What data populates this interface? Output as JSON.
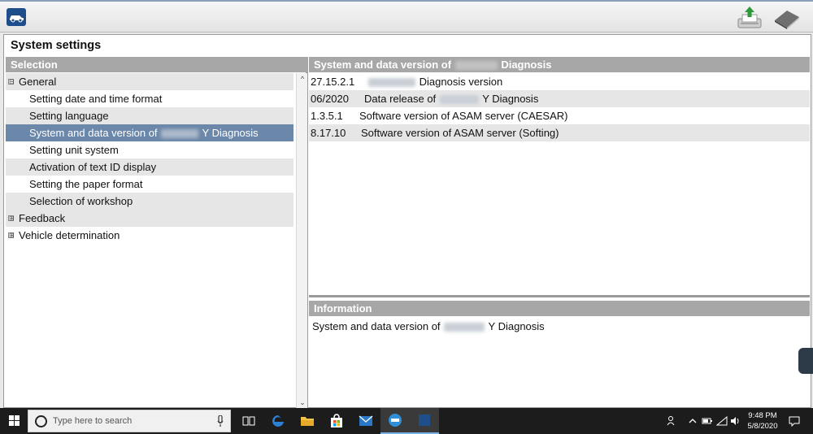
{
  "window": {
    "title": "System settings"
  },
  "left_panel": {
    "header": "Selection",
    "items": [
      {
        "label": "General",
        "level": 0,
        "expander": "⊟"
      },
      {
        "label": "Setting date and time format",
        "level": 1
      },
      {
        "label": "Setting language",
        "level": 1
      },
      {
        "label_pre": "System and data version of",
        "label_post": "Y Diagnosis",
        "level": 1,
        "selected": true
      },
      {
        "label": "Setting unit system",
        "level": 1
      },
      {
        "label": "Activation of text ID display",
        "level": 1
      },
      {
        "label": "Setting the paper format",
        "level": 1
      },
      {
        "label": "Selection of workshop",
        "level": 1
      },
      {
        "label": "Feedback",
        "level": 0,
        "expander": "⊞"
      },
      {
        "label": "Vehicle determination",
        "level": 0,
        "expander": "⊞"
      }
    ]
  },
  "right_panel": {
    "header_pre": "System and data version of",
    "header_post": "Diagnosis",
    "rows": [
      {
        "version": "27.15.2.1",
        "desc_pre": "",
        "desc_post": "Diagnosis version"
      },
      {
        "version": "06/2020",
        "desc_pre": "Data release of",
        "desc_post": "Y Diagnosis"
      },
      {
        "version": "1.3.5.1",
        "desc_pre": "Software version of ASAM server (CAESAR)",
        "desc_post": ""
      },
      {
        "version": "8.17.10",
        "desc_pre": "Software version of ASAM server (Softing)",
        "desc_post": ""
      }
    ],
    "info_header": "Information",
    "info_pre": "System and data version of",
    "info_post": "Y Diagnosis"
  },
  "taskbar": {
    "search_placeholder": "Type here to search",
    "time": "9:48 PM",
    "date": "5/8/2020"
  },
  "colors": {
    "selection": "#6b87a9",
    "header": "#a7a7a7",
    "alt_row": "#e6e6e6",
    "taskbar": "#1c1c1c"
  },
  "icons": {
    "app_logo": "car-logo-icon",
    "print": "print-upload-icon",
    "manual": "book-icon",
    "start": "windows-logo-icon",
    "search": "search-circle-icon",
    "mic": "microphone-icon",
    "task_view": "task-view-icon",
    "edge": "edge-browser-icon",
    "explorer": "file-explorer-icon",
    "store": "store-icon",
    "mail": "mail-icon",
    "xentry": "xentry-app-icon",
    "blank_app": "app-icon",
    "people": "people-icon",
    "chevron_up": "chevron-up-icon",
    "battery": "battery-icon",
    "network": "wifi-icon",
    "volume": "volume-icon",
    "notifications": "notification-icon"
  }
}
